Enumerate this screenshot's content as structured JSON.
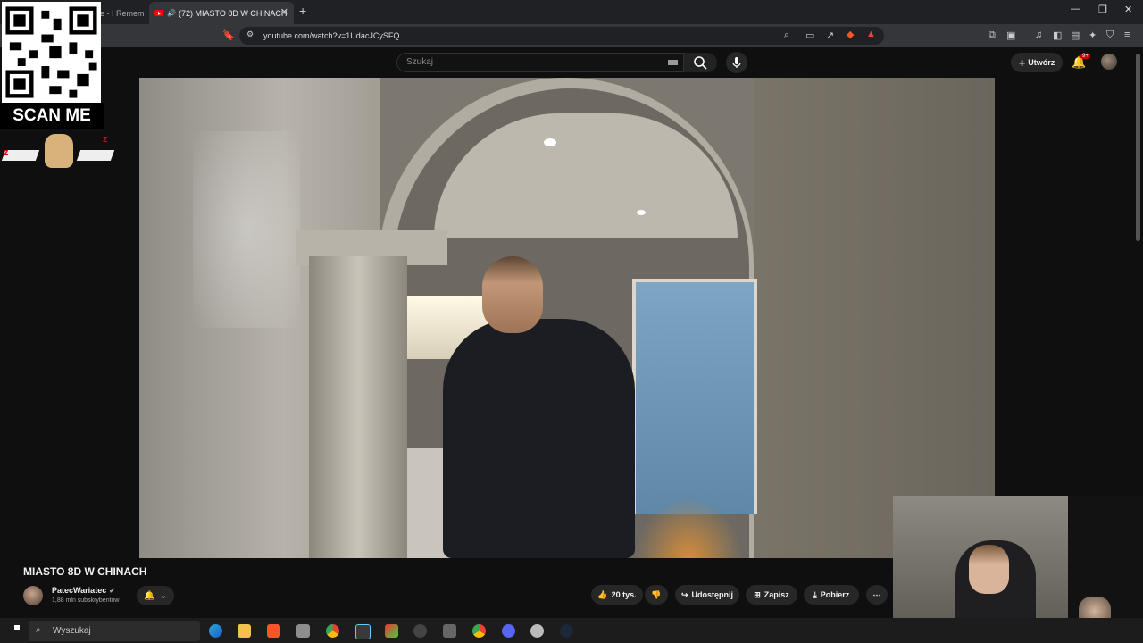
{
  "browser": {
    "inactive_tab": "e - I Remem",
    "active_tab": "(72) MIASTO 8D W CHINACH",
    "url": "youtube.com/watch?v=1UdacJCySFQ"
  },
  "youtube": {
    "search_placeholder": "Szukaj",
    "create_label": "Utwórz",
    "notifications": "9+"
  },
  "overlay": {
    "scan_label": "SCAN ME"
  },
  "video": {
    "title": "MIASTO 8D W CHINACH",
    "channel": "PatecWariatec",
    "subscribers": "1,88 mln subskrybentów",
    "likes": "20 tys.",
    "share_label": "Udostępnij",
    "save_label": "Zapisz",
    "download_label": "Pobierz"
  },
  "taskbar": {
    "search_placeholder": "Wyszukaj"
  },
  "colors": {
    "youtube_red": "#ff0000",
    "background": "#0f0f0f"
  }
}
